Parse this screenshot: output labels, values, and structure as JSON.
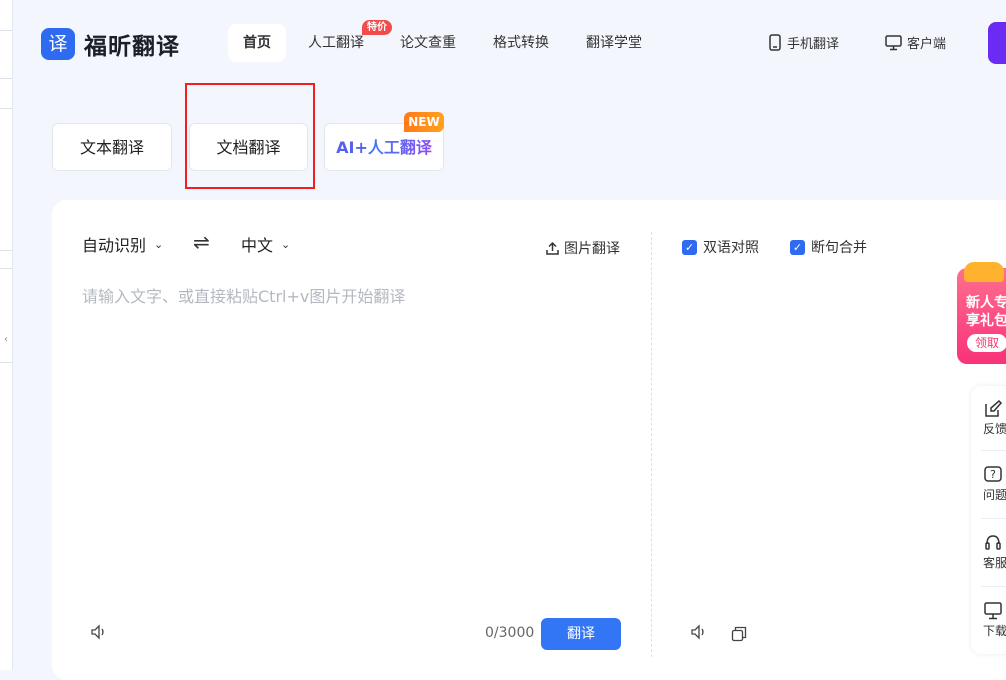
{
  "app": {
    "logo_char": "译",
    "name": "福昕翻译"
  },
  "nav": [
    {
      "label": "首页",
      "active": true
    },
    {
      "label": "人工翻译",
      "badge": "特价"
    },
    {
      "label": "论文查重"
    },
    {
      "label": "格式转换"
    },
    {
      "label": "翻译学堂"
    }
  ],
  "right_nav": {
    "mobile": "手机翻译",
    "client": "客户端"
  },
  "tabs": [
    {
      "label": "文本翻译"
    },
    {
      "label": "文档翻译"
    },
    {
      "label_prefix": "AI+",
      "label_main": "人工翻译",
      "badge": "NEW"
    }
  ],
  "source": {
    "lang": "自动识别",
    "image_translate": "图片翻译",
    "placeholder": "请输入文字、或直接粘贴Ctrl+v图片开始翻译",
    "counter": "0/3000",
    "translate_button": "翻译"
  },
  "target": {
    "lang": "中文",
    "bilingual_label": "双语对照",
    "bilingual_checked": true,
    "merge_label": "断句合并",
    "merge_checked": true
  },
  "promo": {
    "line1": "新人专",
    "line2": "享礼包",
    "button": "领取"
  },
  "side_tools": [
    {
      "label": "反馈",
      "icon": "edit-icon"
    },
    {
      "label": "问题",
      "icon": "question-icon"
    },
    {
      "label": "客服",
      "icon": "headset-icon"
    },
    {
      "label": "下载",
      "icon": "monitor-icon"
    }
  ],
  "colors": {
    "primary": "#3276f5",
    "highlight_box": "#ee2020",
    "badge_red": "#f24b4b",
    "badge_new": "#ff8a1e"
  }
}
